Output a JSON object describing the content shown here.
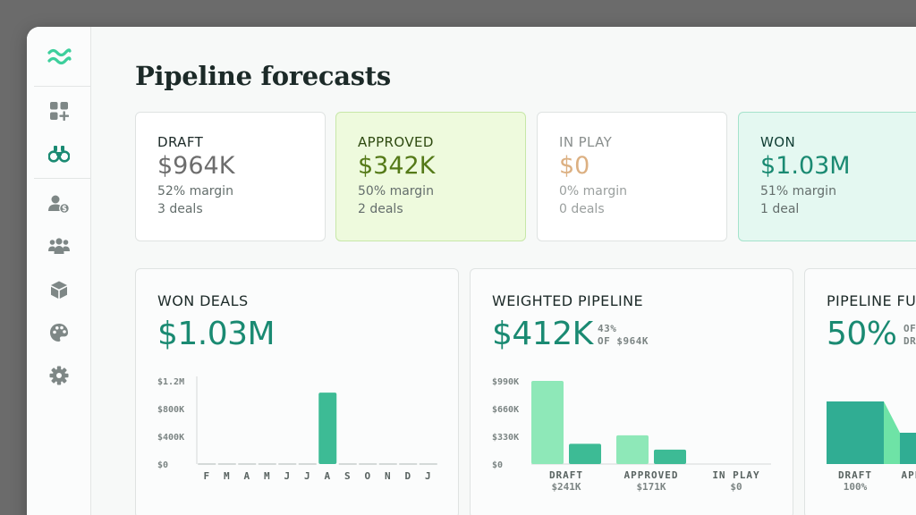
{
  "page": {
    "title": "Pipeline forecasts"
  },
  "sidebar": {
    "logo": "logo-waves-icon",
    "items": [
      {
        "name": "dashboard-add-icon"
      },
      {
        "name": "binoculars-icon",
        "active": true
      },
      {
        "name": "user-dollar-icon"
      },
      {
        "name": "team-icon"
      },
      {
        "name": "box-icon"
      },
      {
        "name": "palette-icon"
      },
      {
        "name": "gear-icon"
      }
    ]
  },
  "summary": [
    {
      "label": "DRAFT",
      "value": "$964K",
      "margin": "52% margin",
      "deals": "3 deals"
    },
    {
      "label": "APPROVED",
      "value": "$342K",
      "margin": "50% margin",
      "deals": "2 deals"
    },
    {
      "label": "IN PLAY",
      "value": "$0",
      "margin": "0% margin",
      "deals": "0 deals"
    },
    {
      "label": "WON",
      "value": "$1.03M",
      "margin": "51% margin",
      "deals": "1 deal"
    }
  ],
  "colors": {
    "accent": "#1a8a72",
    "bar_dark": "#3dbb95",
    "bar_light": "#8ee8b8"
  },
  "won_deals": {
    "title": "WON DEALS",
    "value": "$1.03M",
    "chart_data": {
      "type": "bar",
      "categories": [
        "F",
        "M",
        "A",
        "M",
        "J",
        "J",
        "A",
        "S",
        "O",
        "N",
        "D",
        "J"
      ],
      "values": [
        0,
        0,
        0,
        0,
        0,
        0,
        1.03,
        0,
        0,
        0,
        0,
        0
      ],
      "yticks": [
        "$0",
        "$400K",
        "$800K",
        "$1.2M"
      ],
      "ytick_values": [
        0,
        0.4,
        0.8,
        1.2
      ],
      "ylim": [
        0,
        1.2
      ]
    }
  },
  "weighted_pipeline": {
    "title": "WEIGHTED PIPELINE",
    "value": "$412K",
    "note_pct": "43%",
    "note_of": "OF $964K",
    "chart_data": {
      "type": "bar",
      "categories": [
        "DRAFT",
        "APPROVED",
        "IN PLAY"
      ],
      "category_values": [
        "$241K",
        "$171K",
        "$0"
      ],
      "series": [
        {
          "values": [
            990,
            342,
            0
          ]
        },
        {
          "values": [
            241,
            171,
            0
          ]
        }
      ],
      "yticks": [
        "$0",
        "$330K",
        "$660K",
        "$990K"
      ],
      "ytick_values": [
        0,
        330,
        660,
        990
      ],
      "ylim": [
        0,
        990
      ]
    }
  },
  "pipeline_funnel": {
    "title": "PIPELINE FUNNEL",
    "value": "50%",
    "note_a": "OF",
    "note_b": "DRAFT",
    "chart_data": {
      "type": "area",
      "categories": [
        "DRAFT",
        "APPROVED"
      ],
      "category_values": [
        "100%",
        ""
      ],
      "values": [
        100,
        50
      ]
    }
  }
}
